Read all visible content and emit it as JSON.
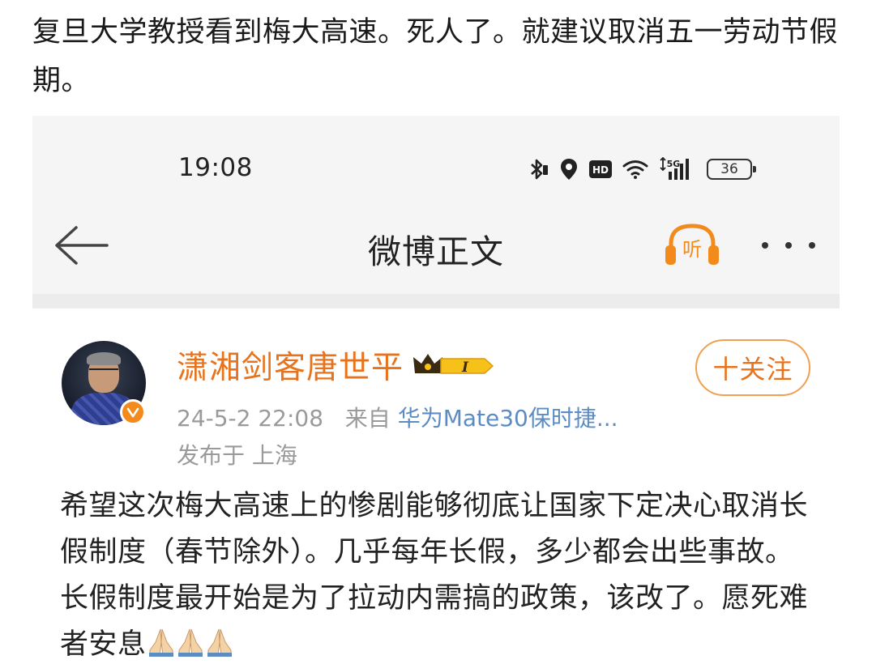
{
  "headline": "复旦大学教授看到梅大高速。死人了。就建议取消五一劳动节假期。",
  "status_bar": {
    "time": "19:08",
    "battery": "36",
    "icons": [
      "bluetooth-icon",
      "location-icon",
      "hd-icon",
      "wifi-icon",
      "signal-5g-icon",
      "battery-icon"
    ]
  },
  "nav": {
    "back_icon": "back-arrow-icon",
    "title": "微博正文",
    "listen_label": "听",
    "more_icon": "more-icon"
  },
  "post": {
    "username": "潇湘剑客唐世平",
    "vip_level": "I",
    "follow_label": "十关注",
    "timestamp": "24-5-2 22:08",
    "source_prefix": "来自",
    "device": "华为Mate30保时捷...",
    "location": "发布于 上海",
    "text": "希望这次梅大高速上的惨剧能够彻底让国家下定决心取消长假制度（春节除外）。几乎每年长假，多少都会出些事故。长假制度最开始是为了拉动内需搞的政策，该改了。愿死难者安息",
    "emoji": [
      "pray-emoji",
      "pray-emoji",
      "pray-emoji"
    ]
  },
  "colors": {
    "accent_orange": "#e8731d",
    "link_blue": "#5b8cc4",
    "meta_gray": "#9a9a9a"
  }
}
